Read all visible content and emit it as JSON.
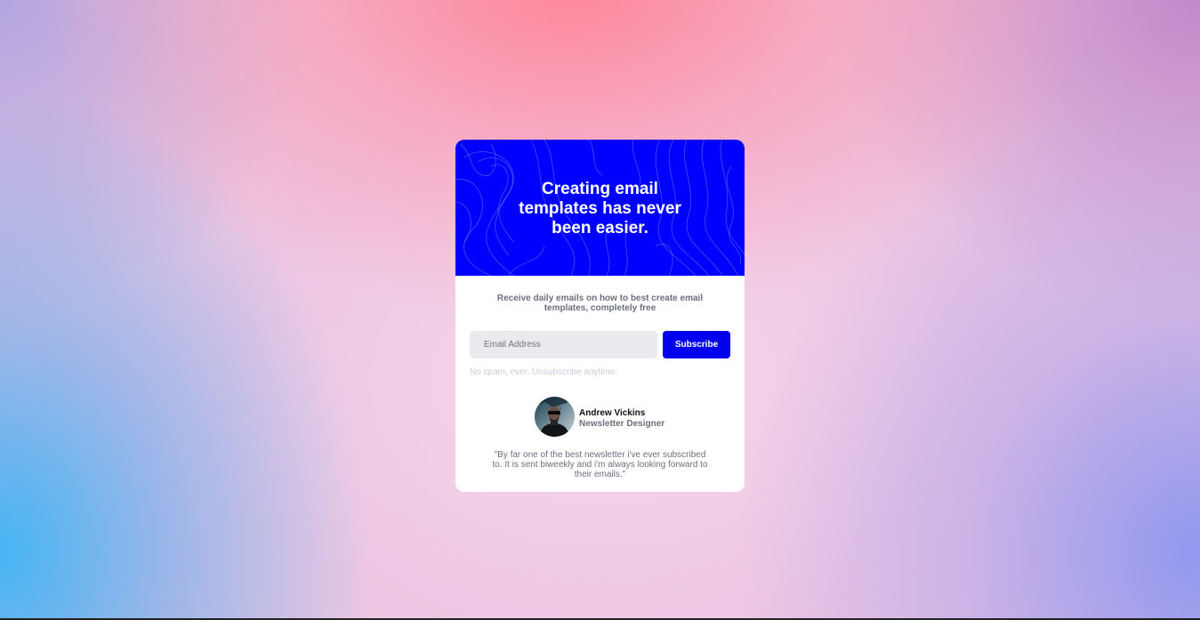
{
  "card": {
    "hero_title": "Creating email templates has never been easier.",
    "intro_text": "Receive daily emails on how to best create email templates, completely free",
    "email": {
      "value": "",
      "placeholder": "Email Address"
    },
    "subscribe_label": "Subscribe",
    "disclaimer": "No spam, ever. Unsubscribe anytime.",
    "author": {
      "name": "Andrew Vickins",
      "role": "Newsletter Designer"
    },
    "testimonial": "\"By far one of the best newsletter i've ever subscribed to. It is sent biweekly and i'm always looking forward to their emails.\""
  },
  "colors": {
    "hero_background": "#0000fe",
    "button_background": "#0000ee",
    "card_background": "#ffffff",
    "input_background": "#e9ebee",
    "muted_text": "#6b6f7d"
  },
  "icons": {
    "hero_pattern": "topographic-contour-lines",
    "avatar": "author-portrait-photo"
  }
}
